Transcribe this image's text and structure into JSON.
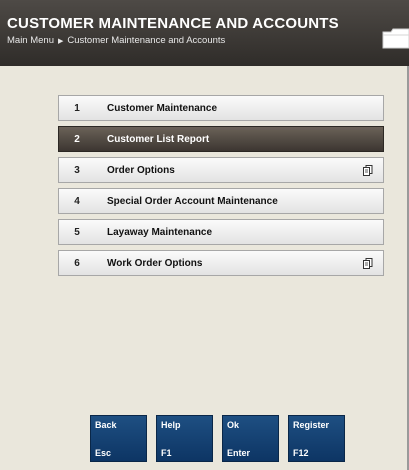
{
  "header": {
    "title": "CUSTOMER MAINTENANCE AND ACCOUNTS",
    "breadcrumb": [
      "Main Menu",
      "Customer Maintenance and Accounts"
    ]
  },
  "menu": {
    "items": [
      {
        "num": "1",
        "label": "Customer Maintenance",
        "selected": false,
        "has_submenu": false
      },
      {
        "num": "2",
        "label": "Customer List Report",
        "selected": true,
        "has_submenu": false
      },
      {
        "num": "3",
        "label": "Order Options",
        "selected": false,
        "has_submenu": true
      },
      {
        "num": "4",
        "label": "Special Order Account Maintenance",
        "selected": false,
        "has_submenu": false
      },
      {
        "num": "5",
        "label": "Layaway Maintenance",
        "selected": false,
        "has_submenu": false
      },
      {
        "num": "6",
        "label": "Work Order Options",
        "selected": false,
        "has_submenu": true
      }
    ]
  },
  "function_keys": [
    {
      "label": "Back",
      "key": "Esc"
    },
    {
      "label": "Help",
      "key": "F1"
    },
    {
      "label": "Ok",
      "key": "Enter"
    },
    {
      "label": "Register",
      "key": "F12"
    }
  ],
  "icons": {
    "folder": "folder-icon",
    "submenu": "submenu-icon",
    "breadcrumb_separator": "breadcrumb-arrow-icon"
  },
  "colors": {
    "header_bg": "#3a3632",
    "content_bg": "#eae7dc",
    "selected_item": "#4a433c",
    "fkey_bg": "#15426f"
  }
}
